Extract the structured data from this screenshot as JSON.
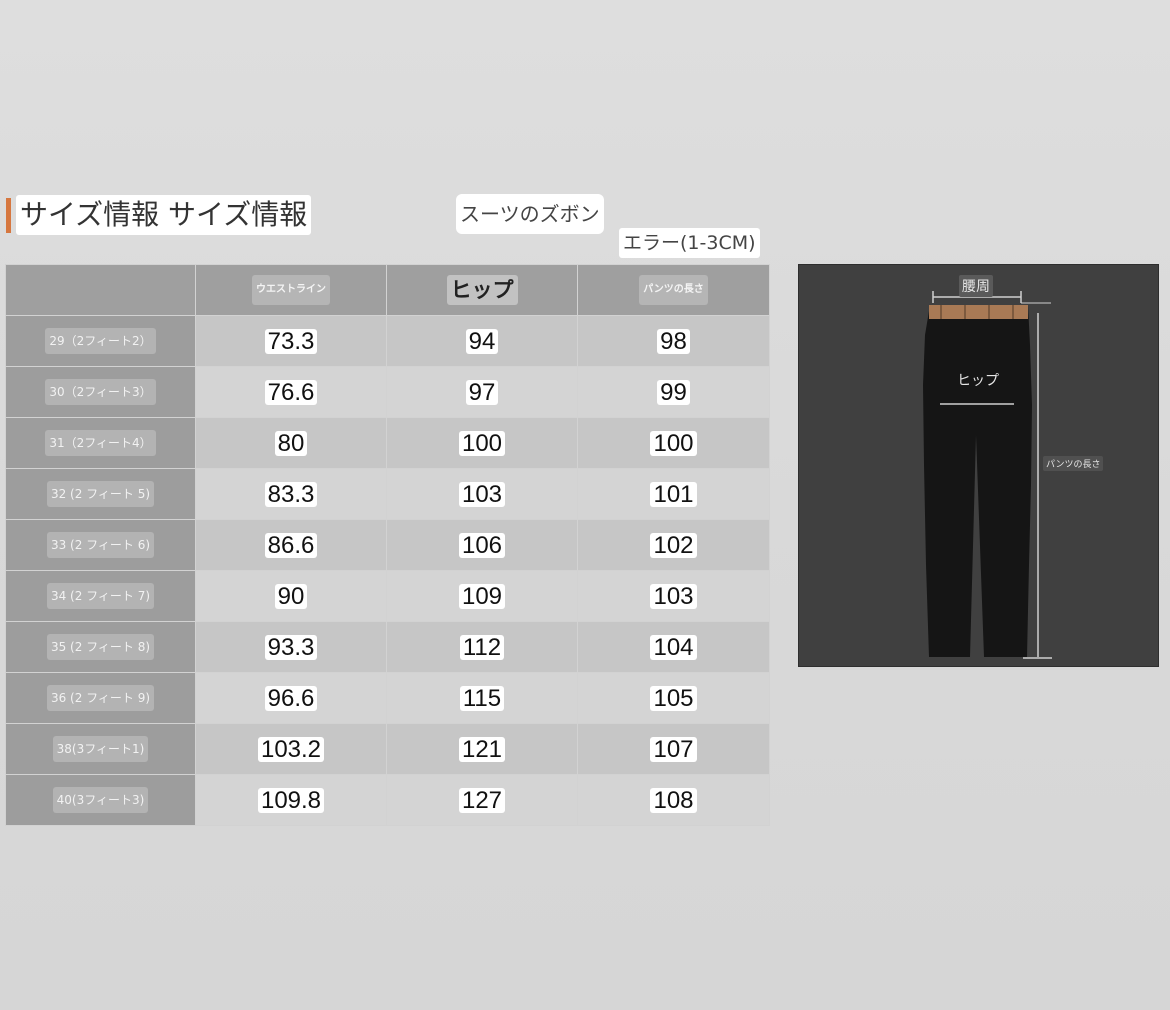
{
  "header": {
    "title": "サイズ情報 サイズ情報",
    "subtitle": "スーツのズボン",
    "tolerance": "エラー(1-3CM)"
  },
  "table": {
    "columns": [
      "",
      "ウエストライン",
      "ヒップ",
      "パンツの長さ"
    ],
    "rows": [
      {
        "size": "29（2フィート2）",
        "waist": "73.3",
        "hip": "94",
        "length": "98"
      },
      {
        "size": "30（2フィート3）",
        "waist": "76.6",
        "hip": "97",
        "length": "99"
      },
      {
        "size": "31（2フィート4）",
        "waist": "80",
        "hip": "100",
        "length": "100"
      },
      {
        "size": "32 (2 フィート 5)",
        "waist": "83.3",
        "hip": "103",
        "length": "101"
      },
      {
        "size": "33 (2 フィート 6)",
        "waist": "86.6",
        "hip": "106",
        "length": "102"
      },
      {
        "size": "34 (2 フィート 7)",
        "waist": "90",
        "hip": "109",
        "length": "103"
      },
      {
        "size": "35 (2 フィート 8)",
        "waist": "93.3",
        "hip": "112",
        "length": "104"
      },
      {
        "size": "36 (2 フィート 9)",
        "waist": "96.6",
        "hip": "115",
        "length": "105"
      },
      {
        "size": "38(3フィート1)",
        "waist": "103.2",
        "hip": "121",
        "length": "107"
      },
      {
        "size": "40(3フィート3)",
        "waist": "109.8",
        "hip": "127",
        "length": "108"
      }
    ]
  },
  "diagram": {
    "waist_label": "腰周",
    "hip_label": "ヒップ",
    "length_label": "パンツの長さ"
  },
  "colors": {
    "accent": "#d6773f",
    "diagram_bg": "#404040"
  }
}
